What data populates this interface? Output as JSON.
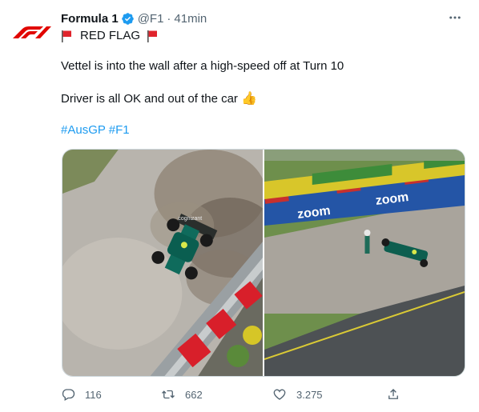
{
  "author": {
    "name": "Formula 1",
    "handle": "@F1",
    "separator": "·",
    "time": "41min",
    "avatar_icon": "f1-logo-icon",
    "brand_color": "#e10600",
    "verified": true
  },
  "tweet": {
    "line1": "RED FLAG",
    "line2": "Vettel is into the wall after a high-speed off at Turn 10",
    "line3": "Driver is all OK and out of the car",
    "thumb_emoji": "👍",
    "hashtags": [
      "#AusGP",
      "#F1"
    ]
  },
  "media": {
    "photos": [
      {
        "name": "crash-photo-left",
        "banner_text": "cognizant"
      },
      {
        "name": "crash-photo-right",
        "banner_text": "zoom"
      }
    ]
  },
  "actions": {
    "replies": "116",
    "retweets": "662",
    "likes": "3.275"
  },
  "colors": {
    "text": "#0f1419",
    "muted": "#536471",
    "link": "#1d9bf0",
    "verified": "#1d9bf0"
  }
}
